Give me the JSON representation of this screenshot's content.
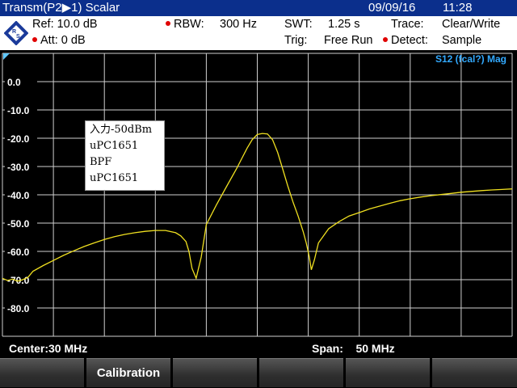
{
  "title_bar": {
    "title": "Transm(P2▶1) Scalar",
    "date": "09/09/16",
    "time": "11:28"
  },
  "settings": {
    "ref": "Ref:  10.0 dB",
    "att": "Att:  0 dB",
    "rbw_label": "RBW:",
    "rbw_value": "300 Hz",
    "swt_label": "SWT:",
    "swt_value": "1.25 s",
    "trig_label": "Trig:",
    "trig_value": "Free Run",
    "trace_label": "Trace:",
    "trace_value": "Clear/Write",
    "detect_label": "Detect:",
    "detect_value": "Sample"
  },
  "logo": {
    "icon": "rohde-schwarz-logo",
    "text": "R&S"
  },
  "colors": {
    "title_bg": "#0b2f8c",
    "trace": "#f0e020",
    "grid": "#cfcfcf",
    "dot": "#e00000",
    "measure_label": "#33aaff"
  },
  "plot": {
    "measure_label": "S12 (fcal?) Mag",
    "y_ticks": [
      "0.0",
      "-10.0",
      "-20.0",
      "-30.0",
      "-40.0",
      "-50.0",
      "-60.0",
      "-70.0",
      "-80.0"
    ]
  },
  "chart_data": {
    "type": "line",
    "ylim": [
      -90,
      10
    ],
    "xlim": [
      5,
      55
    ],
    "x_unit": "MHz",
    "series": [
      {
        "x": [
          5,
          5.5,
          6,
          6.5,
          7,
          7.5,
          8,
          9,
          10,
          11,
          12,
          13,
          14,
          15,
          16,
          17,
          18,
          19,
          20,
          21,
          22,
          22.5,
          23,
          23.3,
          23.6,
          24,
          24.5,
          25,
          26,
          27,
          28,
          28.5,
          29,
          29.5,
          30,
          30.5,
          31,
          31.5,
          32,
          32.5,
          33,
          33.5,
          34,
          34.5,
          34.8,
          35.1,
          35.3,
          35.6,
          36,
          37,
          38,
          39,
          40,
          41,
          42,
          43,
          44,
          45,
          46,
          47,
          48,
          49,
          50,
          51,
          52,
          53,
          54,
          55
        ],
        "values": [
          -69.5,
          -70.3,
          -69.8,
          -70.5,
          -70,
          -69.2,
          -67,
          -65,
          -63.2,
          -61.4,
          -59.8,
          -58.3,
          -57,
          -55.8,
          -54.8,
          -54,
          -53.4,
          -52.9,
          -52.6,
          -52.6,
          -53.4,
          -54.5,
          -56.5,
          -60,
          -66,
          -69.5,
          -62,
          -50.5,
          -43.5,
          -37,
          -30.5,
          -27,
          -23.5,
          -20.5,
          -18.7,
          -18.3,
          -18.5,
          -20.5,
          -25,
          -31,
          -37,
          -42.5,
          -47.5,
          -53,
          -57,
          -62,
          -66.5,
          -63,
          -57,
          -52,
          -49.5,
          -47.5,
          -46.3,
          -45,
          -44,
          -43,
          -42.1,
          -41.4,
          -40.8,
          -40.3,
          -39.9,
          -39.5,
          -39.1,
          -38.8,
          -38.5,
          -38.3,
          -38.1,
          -37.9
        ]
      }
    ]
  },
  "annotation": {
    "lines": [
      "入力-50dBm",
      "uPC1651",
      "BPF",
      "uPC1651"
    ]
  },
  "center_bar": {
    "center": "Center:30 MHz",
    "span": "Span:    50 MHz"
  },
  "softkeys": [
    "",
    "Calibration",
    "",
    "",
    "",
    ""
  ]
}
